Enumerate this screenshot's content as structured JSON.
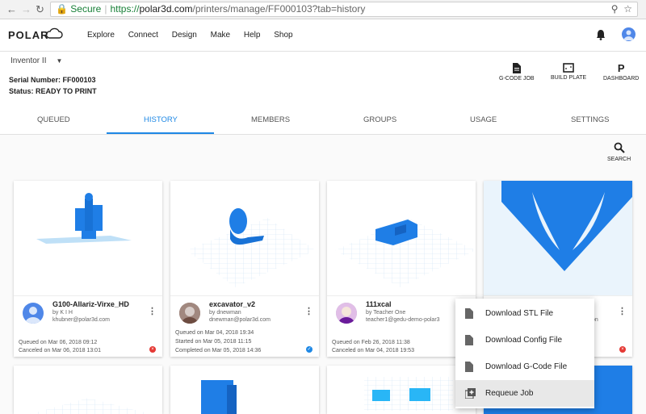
{
  "browser": {
    "secure_label": "Secure",
    "url_proto": "https://",
    "url_host": "polar3d.com",
    "url_rest": "/printers/manage/FF000103?tab=history"
  },
  "header": {
    "logo_text": "POLAR",
    "nav": [
      "Explore",
      "Connect",
      "Design",
      "Make",
      "Help",
      "Shop"
    ]
  },
  "printer": {
    "model": "Inventor II",
    "serial": "Serial Number: FF000103",
    "status": "Status: READY TO PRINT",
    "buttons": [
      {
        "label": "G-CODE JOB",
        "icon": "file-icon"
      },
      {
        "label": "BUILD PLATE",
        "icon": "build-plate-icon"
      },
      {
        "label": "DASHBOARD",
        "icon": "P"
      }
    ]
  },
  "tabs": [
    "QUEUED",
    "HISTORY",
    "MEMBERS",
    "GROUPS",
    "USAGE",
    "SETTINGS"
  ],
  "active_tab": "HISTORY",
  "search_label": "SEARCH",
  "jobs": [
    {
      "name": "G100-Allariz-Virxe_HD",
      "by": "by K I H",
      "email": "khubner@polar3d.com",
      "line1": "Queued on Mar 06, 2018 09:12",
      "line2": "Canceled on Mar 06, 2018 13:01",
      "line3": "",
      "status": "canceled"
    },
    {
      "name": "excavator_v2",
      "by": "by dnewman",
      "email": "dnewman@polar3d.com",
      "line1": "Queued on Mar 04, 2018 19:34",
      "line2": "Started on Mar 05, 2018 11:15",
      "line3": "Completed on Mar 05, 2018 14:36",
      "status": "completed"
    },
    {
      "name": "111xcal",
      "by": "by Teacher One",
      "email": "teacher1@gedu-demo-polar3",
      "line1": "Queued on Feb 26, 2018 11:38",
      "line2": "Canceled on Mar 04, 2018 19:53",
      "line3": "",
      "status": "canceled"
    },
    {
      "name": "",
      "by": "",
      "email": "on",
      "line1": "",
      "line2": "",
      "line3": "",
      "status": "canceled"
    }
  ],
  "context_menu": [
    {
      "label": "Download STL File",
      "icon": "file-icon"
    },
    {
      "label": "Download Config File",
      "icon": "file-icon"
    },
    {
      "label": "Download G-Code File",
      "icon": "file-icon"
    },
    {
      "label": "Requeue Job",
      "icon": "requeue-icon"
    }
  ],
  "colors": {
    "accent": "#1e88e5",
    "model_blue": "#1f7ee6",
    "cancel_red": "#e53935",
    "complete_blue": "#1e88e5"
  }
}
